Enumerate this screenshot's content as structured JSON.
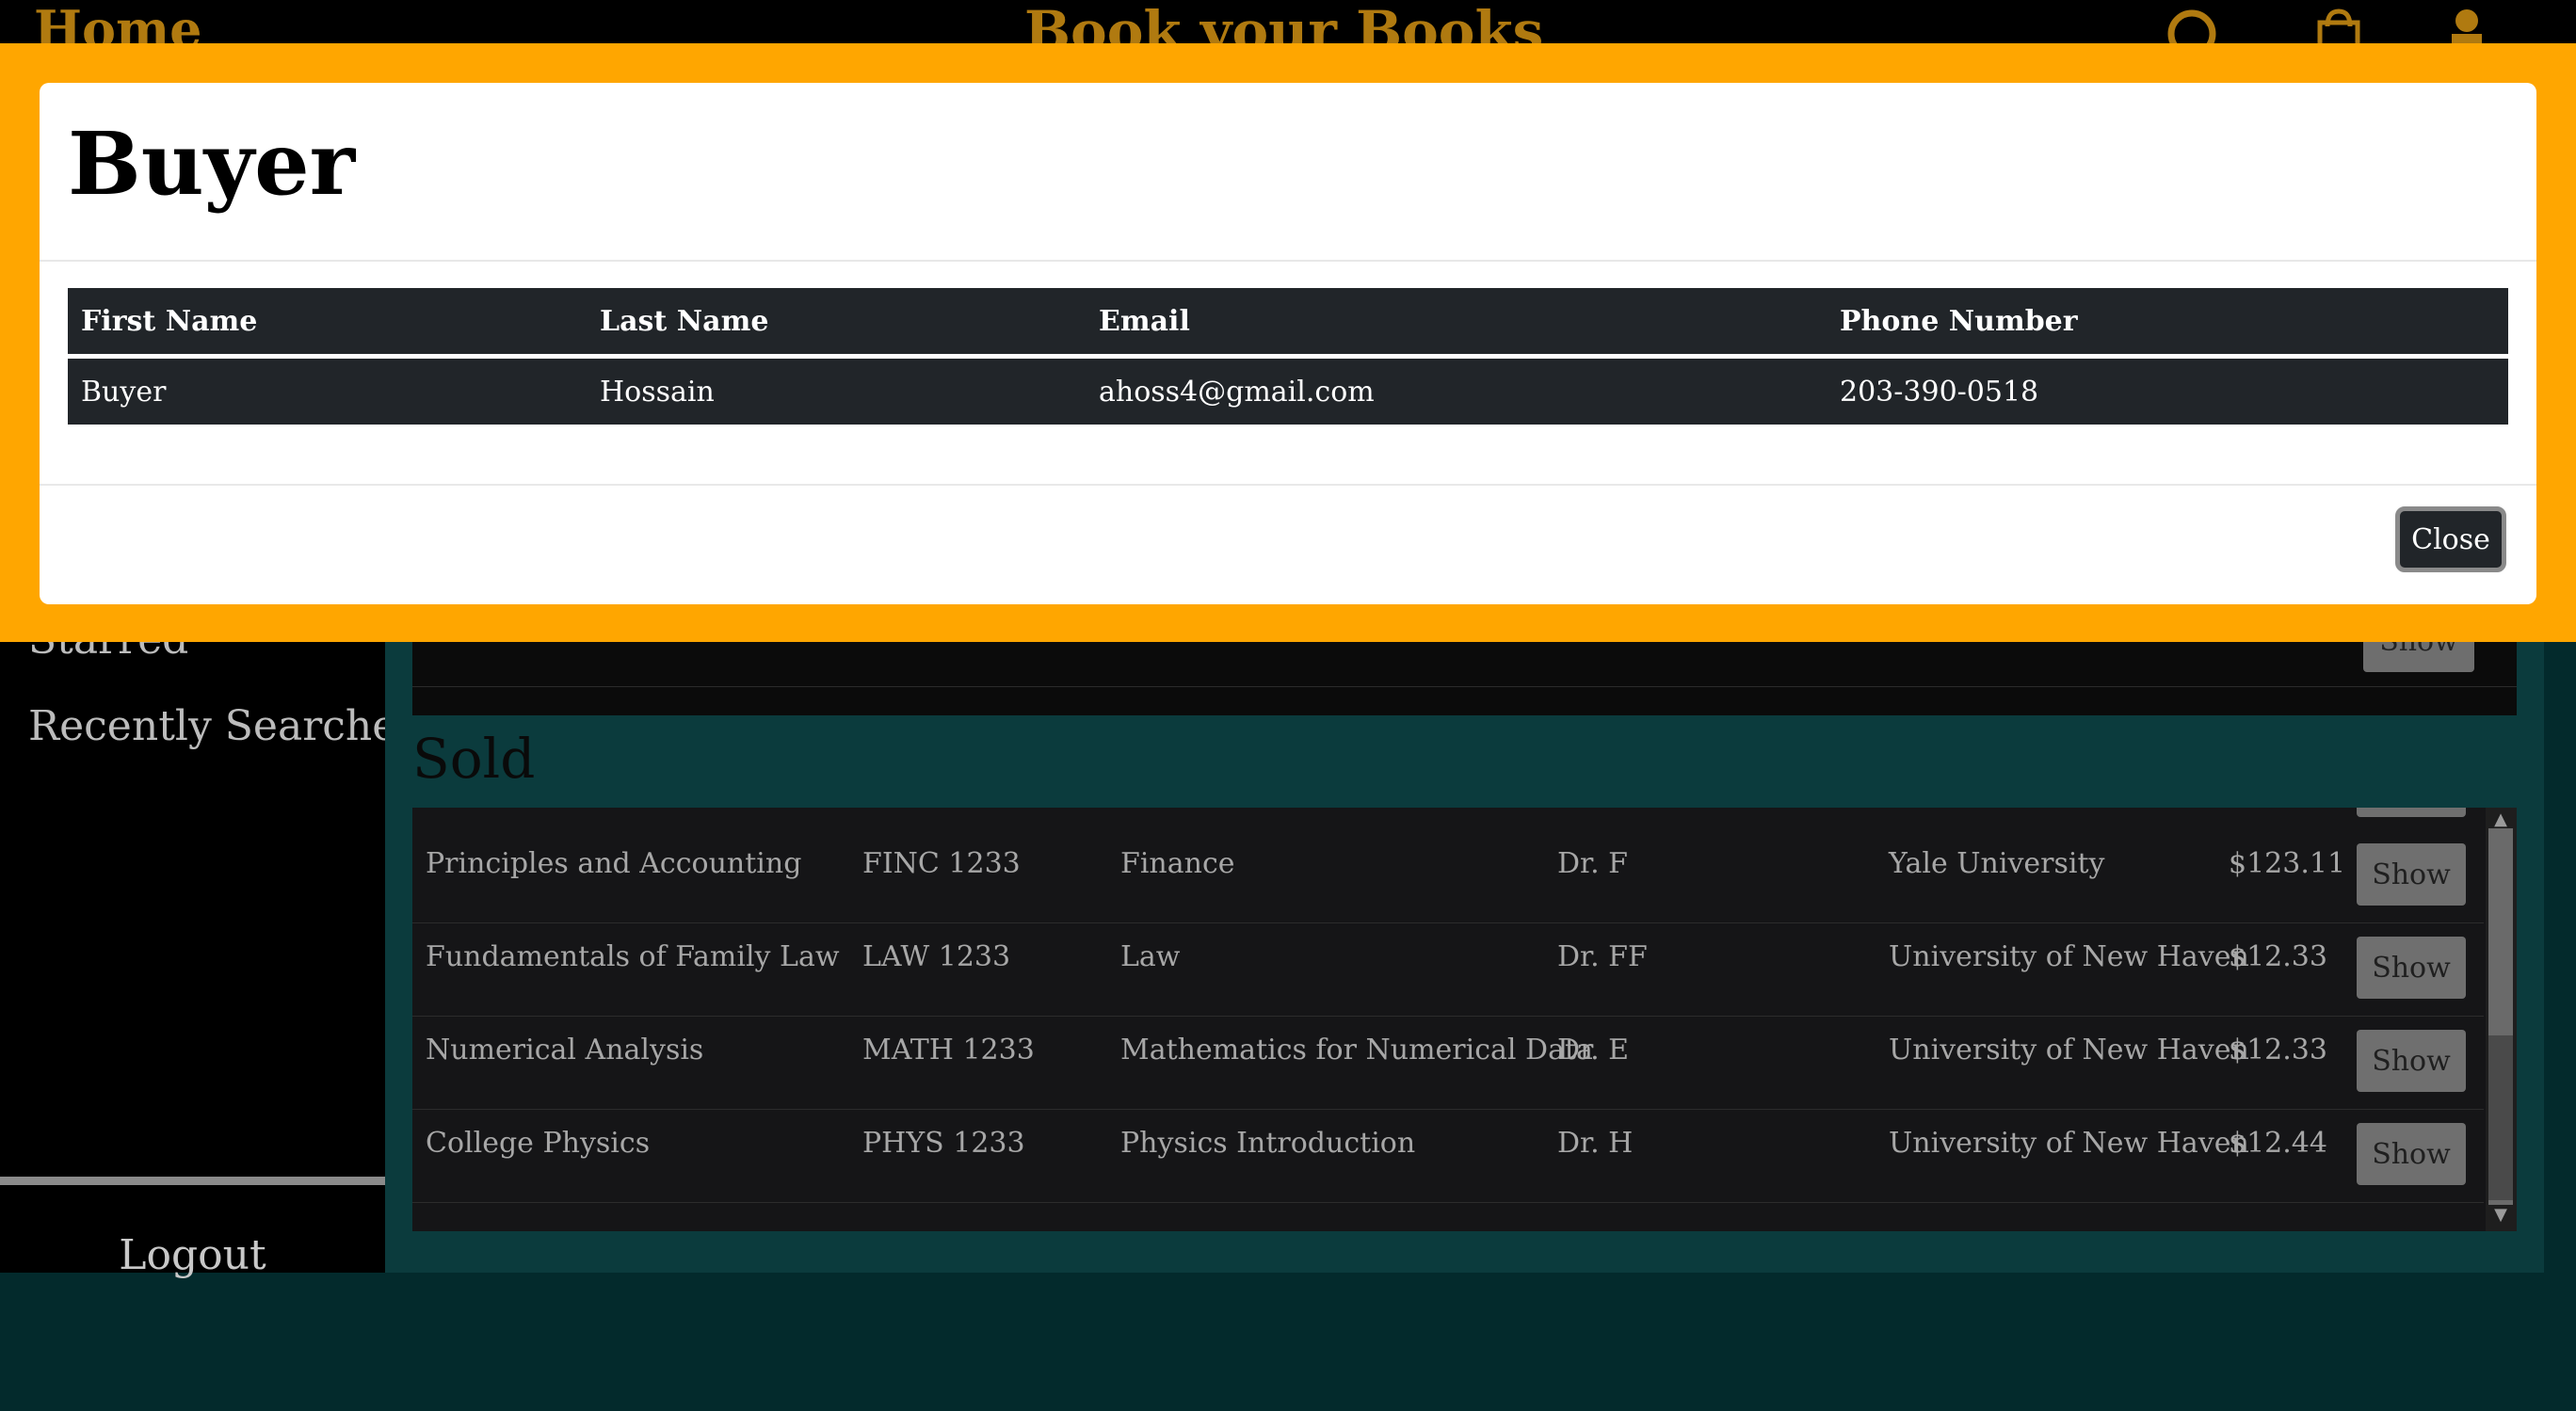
{
  "nav": {
    "home": "Home",
    "title": "Book your Books"
  },
  "sidebar": {
    "starred": "Starred",
    "recent": "Recently Searched",
    "logout": "Logout"
  },
  "upper": {
    "show": "Show"
  },
  "sold": {
    "title": "Sold",
    "rows": [
      {
        "title": "Principles and Accounting",
        "course": "FINC 1233",
        "subject": "Finance",
        "professor": "Dr. F",
        "school": "Yale University",
        "price": "$123.11",
        "action": "Show"
      },
      {
        "title": "Fundamentals of Family Law",
        "course": "LAW 1233",
        "subject": "Law",
        "professor": "Dr. FF",
        "school": "University of New Haven",
        "price": "$12.33",
        "action": "Show"
      },
      {
        "title": "Numerical Analysis",
        "course": "MATH 1233",
        "subject": "Mathematics for Numerical Data",
        "professor": "Dr. E",
        "school": "University of New Haven",
        "price": "$12.33",
        "action": "Show"
      },
      {
        "title": "College Physics",
        "course": "PHYS 1233",
        "subject": "Physics Introduction",
        "professor": "Dr. H",
        "school": "University of New Haven",
        "price": "$12.44",
        "action": "Show"
      }
    ]
  },
  "modal": {
    "title": "Buyer",
    "headers": [
      "First Name",
      "Last Name",
      "Email",
      "Phone Number"
    ],
    "row": [
      "Buyer",
      "Hossain",
      "ahoss4@gmail.com",
      "203-390-0518"
    ],
    "close": "Close"
  },
  "colors": {
    "modal_backdrop": "#ffa600",
    "table_dark": "#212529",
    "main_teal": "#0b3b3d"
  }
}
